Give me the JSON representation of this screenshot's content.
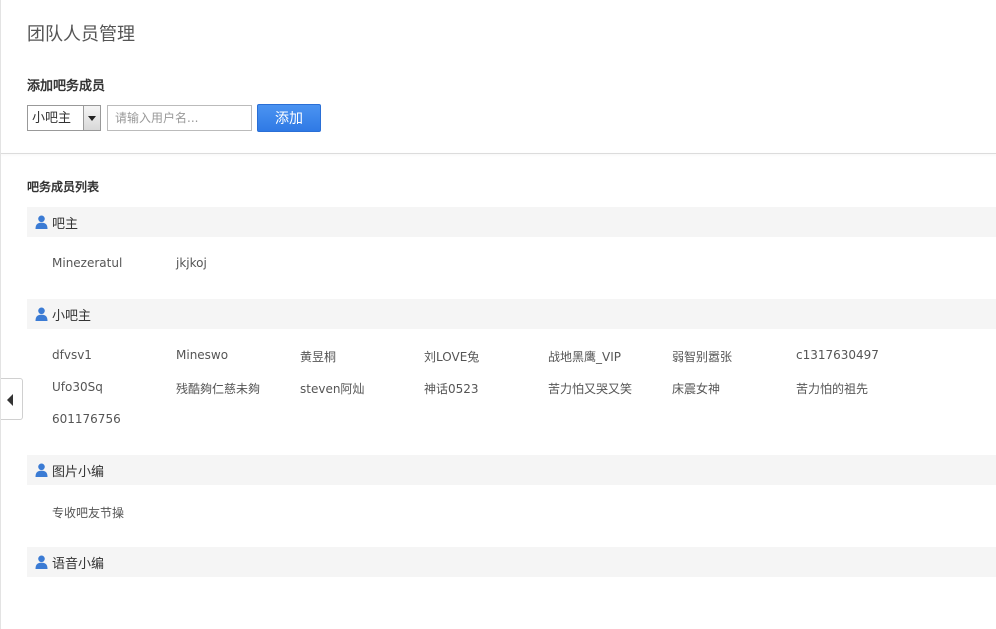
{
  "page": {
    "title": "团队人员管理"
  },
  "add_section": {
    "title": "添加吧务成员",
    "role_selected": "小吧主",
    "username_placeholder": "请输入用户名...",
    "add_label": "添加"
  },
  "list": {
    "title": "吧务成员列表",
    "groups": [
      {
        "label": "吧主",
        "icon": "user-icon",
        "members": [
          "Minezeratul",
          "jkjkoj"
        ]
      },
      {
        "label": "小吧主",
        "icon": "user-icon",
        "members": [
          "dfvsv1",
          "Mineswo",
          "黄昱桐",
          "刘LOVE兔",
          "战地黑鹰_VIP",
          "弱智别嚣张",
          "c1317630497",
          "Ufo30Sq",
          "残酷夠仁慈未夠",
          "steven阿灿",
          "神话0523",
          "苦力怕又哭又笑",
          "床震女神",
          "苦力怕的祖先",
          "601176756"
        ]
      },
      {
        "label": "图片小编",
        "icon": "user-icon",
        "members": [
          "专收吧友节操"
        ]
      },
      {
        "label": "语音小编",
        "icon": "user-icon",
        "members": []
      }
    ]
  },
  "colors": {
    "accent": "#2f7ae5",
    "icon": "#3b7bd4",
    "header_bg": "#f5f5f5"
  }
}
